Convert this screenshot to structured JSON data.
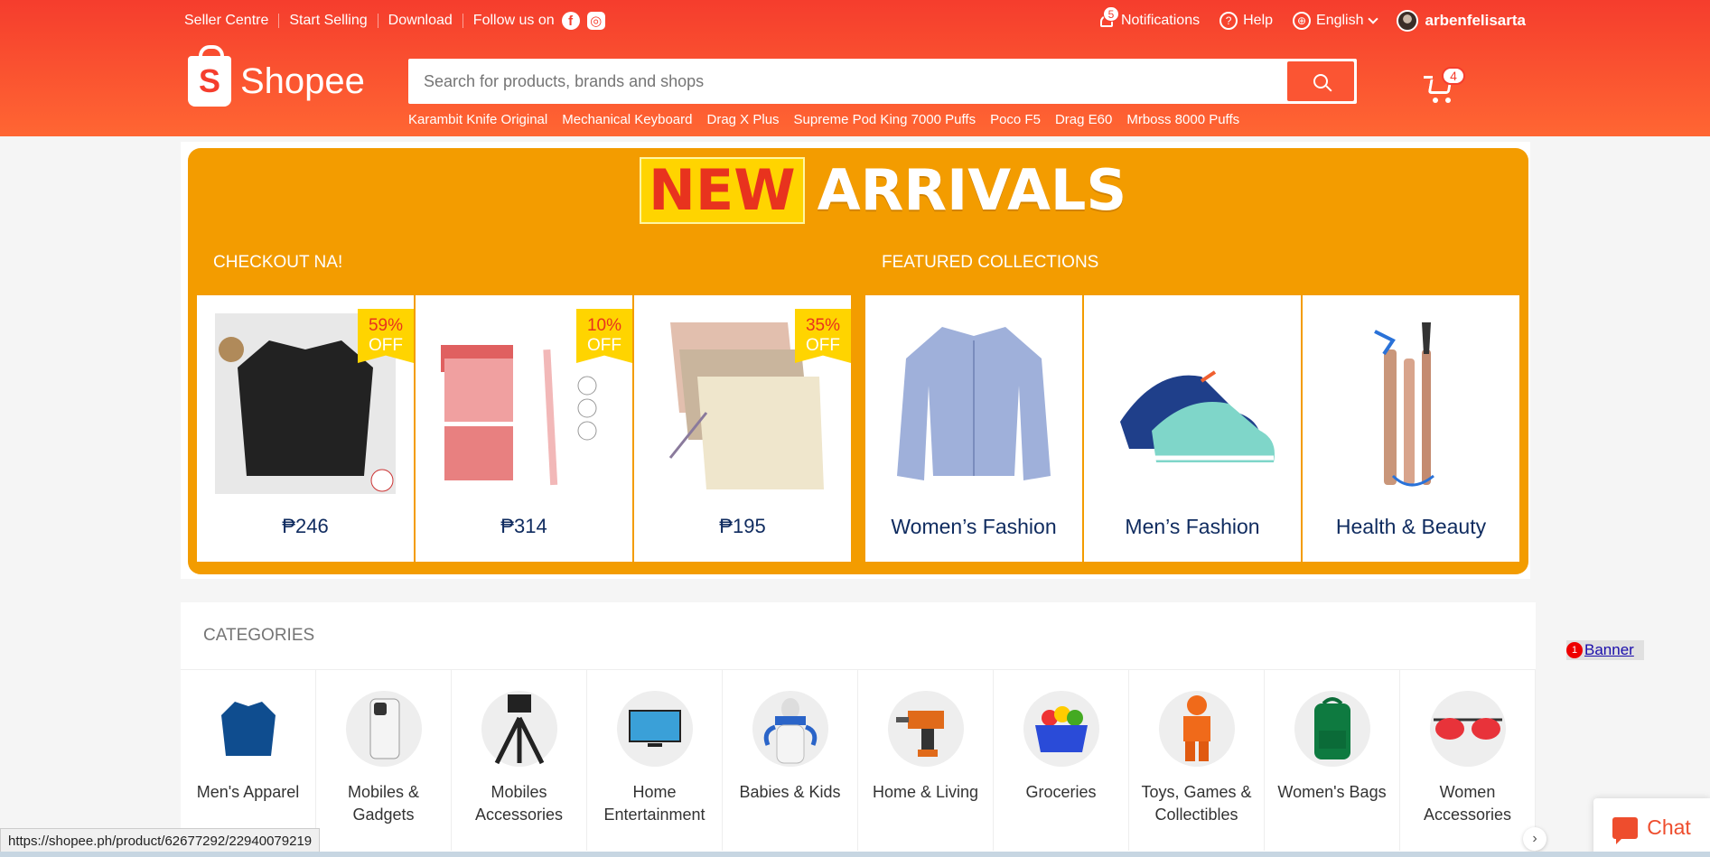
{
  "header": {
    "topbar_left": [
      "Seller Centre",
      "Start Selling",
      "Download"
    ],
    "follow_label": "Follow us on",
    "notifications_label": "Notifications",
    "notifications_count": "5",
    "help_label": "Help",
    "language_label": "English",
    "username": "arbenfelisarta",
    "logo_text": "Shopee",
    "logo_letter": "S",
    "search_placeholder": "Search for products, brands and shops",
    "suggestions": [
      "Karambit Knife Original",
      "Mechanical Keyboard",
      "Drag X Plus",
      "Supreme Pod King 7000 Puffs",
      "Poco F5",
      "Drag E60",
      "Mrboss 8000 Puffs"
    ],
    "cart_count": "4"
  },
  "banner": {
    "title_new": "NEW",
    "title_arrivals": "ARRIVALS",
    "checkout_label": "CHECKOUT NA!",
    "featured_label": "FEATURED COLLECTIONS",
    "products": [
      {
        "price": "₱246",
        "discount": "59%",
        "off": "OFF"
      },
      {
        "price": "₱314",
        "discount": "10%",
        "off": "OFF"
      },
      {
        "price": "₱195",
        "discount": "35%",
        "off": "OFF"
      }
    ],
    "collections": [
      "Women’s Fashion",
      "Men’s Fashion",
      "Health & Beauty"
    ]
  },
  "categories": {
    "title": "CATEGORIES",
    "items": [
      {
        "label": "Men's Apparel"
      },
      {
        "label": "Mobiles & Gadgets"
      },
      {
        "label": "Mobiles Accessories"
      },
      {
        "label": "Home Entertainment"
      },
      {
        "label": "Babies & Kids"
      },
      {
        "label": "Home & Living"
      },
      {
        "label": "Groceries"
      },
      {
        "label": "Toys, Games & Collectibles"
      },
      {
        "label": "Women's Bags"
      },
      {
        "label": "Women Accessories"
      }
    ]
  },
  "floating": {
    "banner_badge": "1",
    "banner_label": "Banner",
    "chat_label": "Chat",
    "status_url": "https://shopee.ph/product/62677292/22940079219"
  },
  "colors": {
    "brand": "#f53d2d",
    "banner_orange": "#f39c00",
    "new_yellow": "#ffd400"
  }
}
